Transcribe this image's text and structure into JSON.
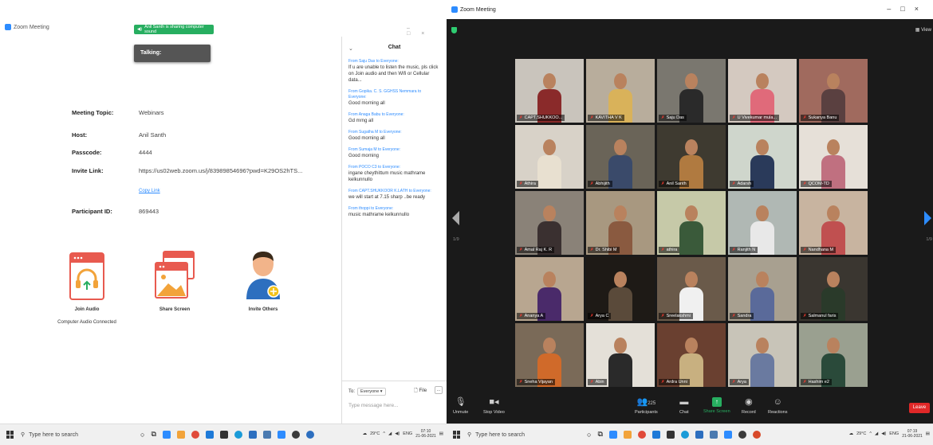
{
  "left_window": {
    "title": "Zoom Meeting",
    "share_banner": "Anil Santh is sharing computer sound",
    "talking_label": "Talking:",
    "info": [
      {
        "key": "Meeting Topic:",
        "value": "Webinars"
      },
      {
        "key": "Host:",
        "value": "Anil Santh"
      },
      {
        "key": "Passcode:",
        "value": "4444"
      },
      {
        "key": "Invite Link:",
        "value": "https://us02web.zoom.us/j/83989854696?pwd=K29OS2hTS..."
      },
      {
        "key": "Participant ID:",
        "value": "869443"
      }
    ],
    "copy_link": "Copy Link",
    "actions": {
      "join_audio": "Join Audio",
      "join_audio_status": "Computer Audio Connected",
      "share_screen": "Share Screen",
      "invite_others": "Invite Others"
    },
    "chat": {
      "title": "Chat",
      "messages": [
        {
          "from": "From Saju Das to Everyone:",
          "text": "If u are unable to listen the music, pls click on Join audio and then Wifi or Cellular data..."
        },
        {
          "from": "From Gopika. C. S. GGHSS Nemmara to Everyone:",
          "text": "Good morning all"
        },
        {
          "from": "From Anaga Babu to Everyone:",
          "text": "Gd mrng all"
        },
        {
          "from": "From Sugatha M to Everyone:",
          "text": "Good morning all"
        },
        {
          "from": "From Sumaja M to Everyone:",
          "text": "Good morning"
        },
        {
          "from": "From POCO C3 to Everyone:",
          "text": "ingane cheythittum music mathrame kelkunnullo"
        },
        {
          "from": "From CAPT.SHUKKOOR K.LATH to Everyone:",
          "text": "we will start at 7.15 sharp ..be ready"
        },
        {
          "from": "From thoppi to Everyone:",
          "text": "music mathrame kelkunnullo"
        }
      ],
      "to_label": "To:",
      "to_value": "Everyone",
      "file_label": "File",
      "more_label": "...",
      "input_placeholder": "Type message here..."
    }
  },
  "right_window": {
    "title": "Zoom Meeting",
    "view_label": "View",
    "page_left": "1/9",
    "page_right": "1/9",
    "tiles": [
      {
        "name": "CAPT.SHUKKOO...",
        "bg": "#c9c4bc",
        "body": "#8a2a2a",
        "active": false
      },
      {
        "name": "KAVITHA V K",
        "bg": "#b8ad9c",
        "body": "#d9b25a",
        "active": false
      },
      {
        "name": "Saju Das",
        "bg": "#7a776f",
        "body": "#2a2a2a",
        "active": true
      },
      {
        "name": "U Vivekumar mula...",
        "bg": "#d4c9c0",
        "body": "#e06a7a",
        "active": false
      },
      {
        "name": "Sukanya Banu",
        "bg": "#a06a5e",
        "body": "#5a4040",
        "active": false
      },
      {
        "name": "Athira",
        "bg": "#d8d2c8",
        "body": "#e8e0d0",
        "active": false
      },
      {
        "name": "Abhijith",
        "bg": "#6a6458",
        "body": "#3a4a6a",
        "active": false
      },
      {
        "name": "Anil Santh",
        "bg": "#3e3a30",
        "body": "#b07a40",
        "active": false
      },
      {
        "name": "Adarsh",
        "bg": "#cfd6cc",
        "body": "#2a3a5a",
        "active": false
      },
      {
        "name": "QCOM-TD",
        "bg": "#e6e0d8",
        "body": "#c07080",
        "active": false
      },
      {
        "name": "Amal Raj K. R",
        "bg": "#8a8278",
        "body": "#3a3030",
        "active": false
      },
      {
        "name": "Dr. Shibi M",
        "bg": "#a89880",
        "body": "#8a5a40",
        "active": false
      },
      {
        "name": "athira",
        "bg": "#c6c9a8",
        "body": "#3a5a3a",
        "active": false
      },
      {
        "name": "Ranjith N",
        "bg": "#b0b8b4",
        "body": "#e8e8e8",
        "active": false
      },
      {
        "name": "Nandhana M",
        "bg": "#c8b4a0",
        "body": "#c05050",
        "active": false
      },
      {
        "name": "Ananya A",
        "bg": "#b8a690",
        "body": "#4a2a6a",
        "active": false
      },
      {
        "name": "Arya C",
        "bg": "#1e1a16",
        "body": "#5a4a3a",
        "active": false
      },
      {
        "name": "Sreelakshmi",
        "bg": "#6a5a4a",
        "body": "#f0f0f0",
        "active": false
      },
      {
        "name": "Sandra",
        "bg": "#a8a090",
        "body": "#5a6a9a",
        "active": false
      },
      {
        "name": "Salmanul faris",
        "bg": "#3a3630",
        "body": "#2a3a2a",
        "active": false
      },
      {
        "name": "Sneha Vijayan",
        "bg": "#7a6a58",
        "body": "#d06a2a",
        "active": false
      },
      {
        "name": "Abin",
        "bg": "#e4e0d8",
        "body": "#2a2a2a",
        "active": false
      },
      {
        "name": "Ardra Unni",
        "bg": "#6a4030",
        "body": "#c8b080",
        "active": false
      },
      {
        "name": "Arya",
        "bg": "#c8c4b8",
        "body": "#6a7aa0",
        "active": false
      },
      {
        "name": "Hashim e2",
        "bg": "#9aa090",
        "body": "#2a4a3a",
        "active": false
      }
    ],
    "toolbar": {
      "unmute": "Unmute",
      "stop_video": "Stop Video",
      "participants": "Participants",
      "participant_count": "225",
      "chat": "Chat",
      "share_screen": "Share Screen",
      "record": "Record",
      "reactions": "Reactions",
      "leave": "Leave"
    }
  },
  "taskbar_left": {
    "search_placeholder": "Type here to search",
    "weather": "29°C",
    "lang": "ENG",
    "time": "07:10",
    "date": "21-06-2021"
  },
  "taskbar_right": {
    "search_placeholder": "Type here to search",
    "weather": "29°C",
    "lang": "ENG",
    "time": "07:19",
    "date": "21-06-2021"
  },
  "colors": {
    "zoom_blue": "#2d8cff",
    "share_green": "#27ae60",
    "leave_red": "#e02828",
    "active_speaker": "#f1e15b"
  }
}
